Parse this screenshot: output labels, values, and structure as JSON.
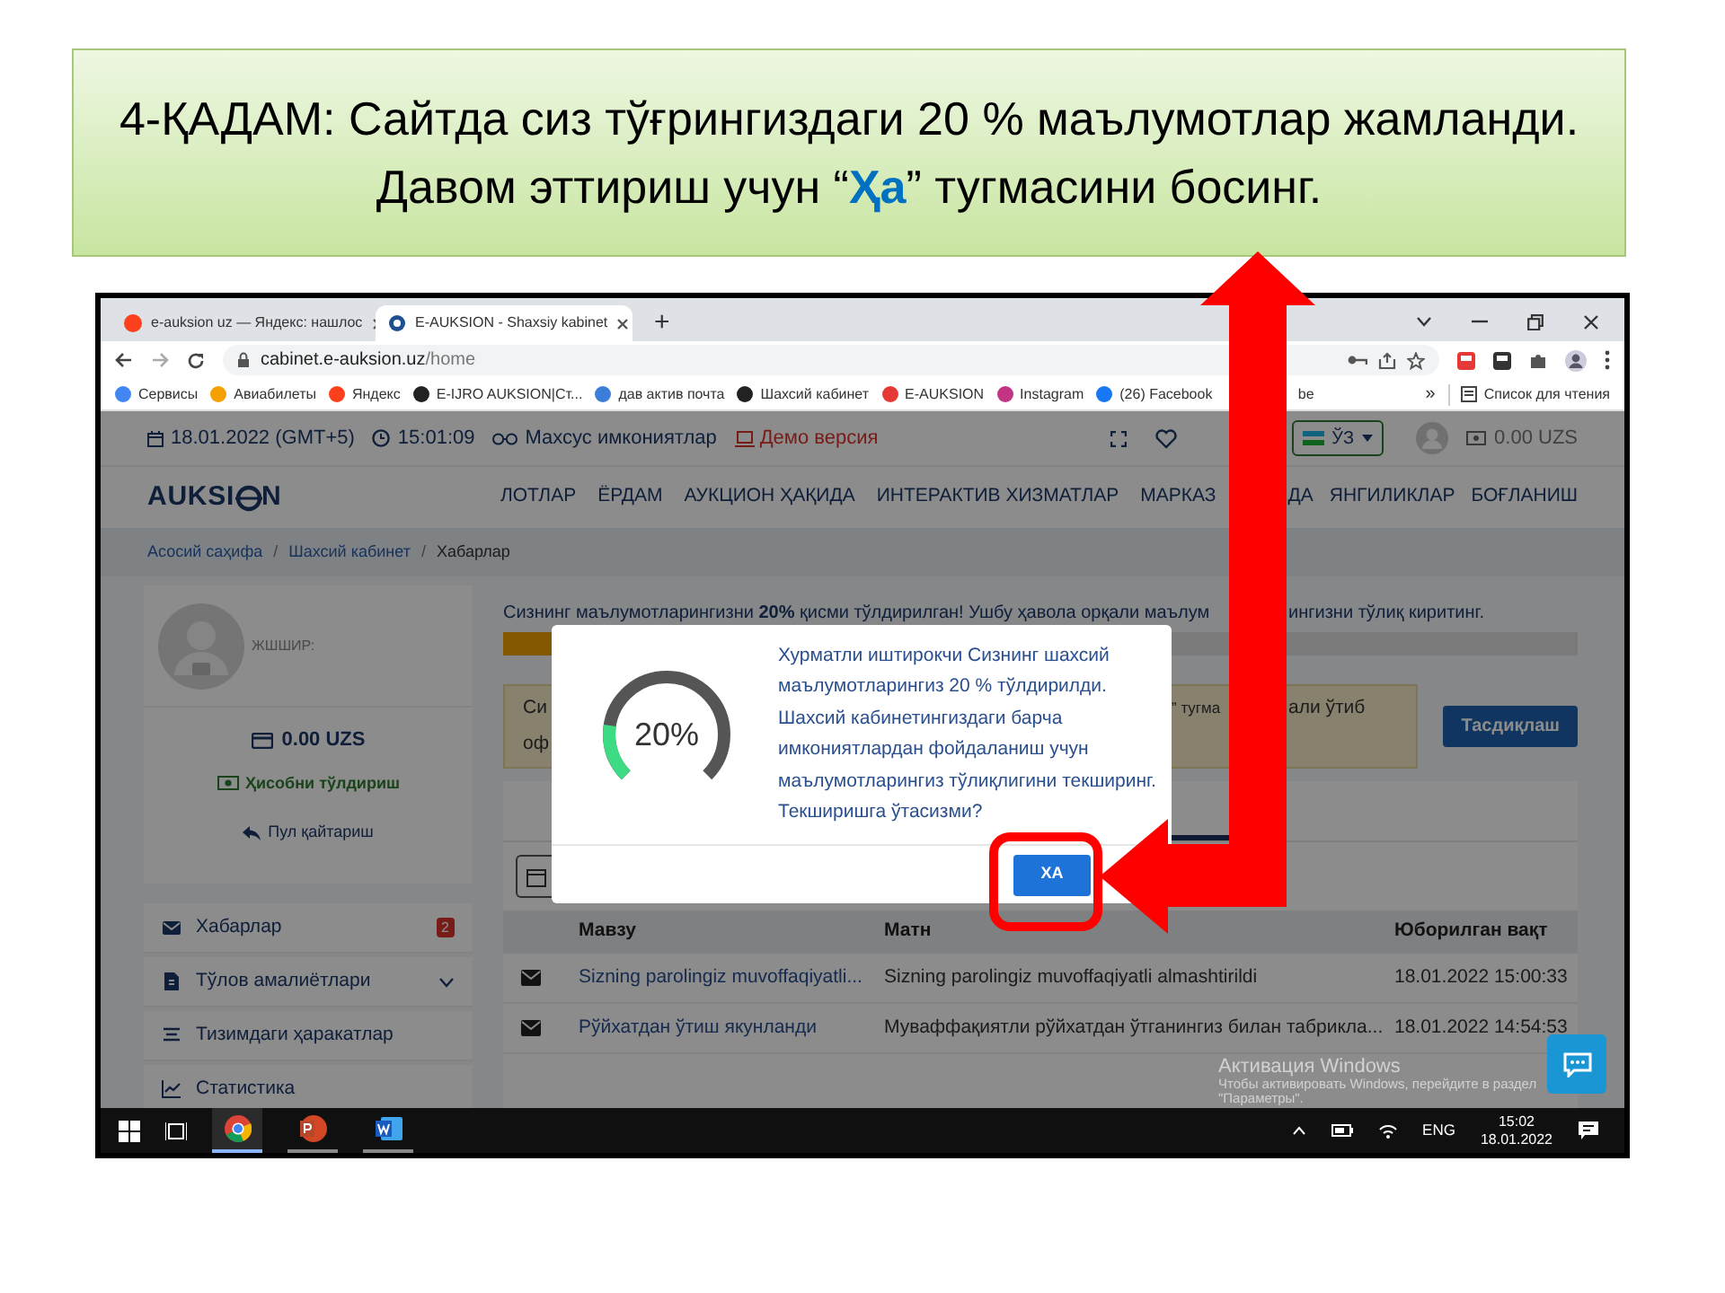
{
  "banner": {
    "text": "4-ҚАДАМ: Сайтда сиз тўғрингиздаги 20 % маълумотлар жамланди. Давом эттириш учун “**Ҳа**” тугмасини босинг."
  },
  "browser": {
    "tabs": [
      {
        "title": "e-auksion uz — Яндекс: нашлос",
        "selected": false
      },
      {
        "title": "E-AUKSION - Shaxsiy kabinet",
        "selected": true
      }
    ],
    "new_tab": "+",
    "url": {
      "domain": "cabinet.e-auksion.uz",
      "path": "/home"
    },
    "bookmarks": [
      "Сервисы",
      "Авиабилеты",
      "Яндекс",
      "E-IJRO AUKSION|Ст...",
      "дав актив почта",
      "Шахсий кабинет",
      "E-AUKSION",
      "Instagram",
      "(26) Facebook"
    ],
    "bookmark_tail": "be",
    "more": "»",
    "reading_list": "Список для чтения"
  },
  "topbar": {
    "date": "18.01.2022 (GMT+5)",
    "time": "15:01:09",
    "accessibility": "Махсус имкониятлар",
    "demo": "Демо версия",
    "language": "ЎЗ",
    "balance": "0.00 UZS"
  },
  "logo": {
    "left": "AUKSI",
    "right": "N"
  },
  "nav": [
    "ЛОТЛАР",
    "ЁРДАМ",
    "АУКЦИОН ҲАҚИДА",
    "ИНТЕРАКТИВ ХИЗМАТЛАР",
    "МАРКАЗ",
    "ДА",
    "ЯНГИЛИКЛАР",
    "БОҒЛАНИШ"
  ],
  "breadcrumb": [
    {
      "text": "Асосий саҳифа",
      "kind": "link"
    },
    {
      "text": "/",
      "kind": "separator"
    },
    {
      "text": "Шахсий кабинет",
      "kind": "link"
    },
    {
      "text": "/",
      "kind": "separator"
    },
    {
      "text": "Хабарлар",
      "kind": "current"
    }
  ],
  "profile": {
    "id_label": "ЖШШИР:",
    "balance": "0.00 UZS",
    "top_up": "Ҳисобни тўлдириш",
    "refund": "Пул қайтариш"
  },
  "menu": [
    {
      "label": "Хабарлар",
      "badge": "2"
    },
    {
      "label": "Тўлов амалиётлари",
      "expanded": false
    },
    {
      "label": "Тизимдаги ҳаракатлар"
    },
    {
      "label": "Статистика"
    }
  ],
  "progress": {
    "text_left": "Сизнинг маълумотларингизни **20%** қисми тўлдирилган! Ушбу ҳавола орқали маълум",
    "text_right": "ингизни тўлиқ киритинг.",
    "level": 0.2
  },
  "notice": {
    "line1_start": "Си",
    "line1_mid": "” тугма",
    "line1_end": "али ўтиб",
    "line2_start": "оф",
    "button": "Тасдиқлаш"
  },
  "table": {
    "columns": [
      "Мавзу",
      "Матн",
      "Юборилган вақт"
    ],
    "rows": [
      {
        "subject": "Sizning parolingiz muvoffaqiyatli...",
        "text": "Sizning parolingiz muvoffaqiyatli almashtirildi",
        "sent": "18.01.2022 15:00:33"
      },
      {
        "subject": "Рўйхатдан ўтиш якунланди",
        "text": "Муваффақиятли рўйхатдан ўтганингиз билан табрикла...",
        "sent": "18.01.2022 14:54:53"
      }
    ]
  },
  "modal": {
    "gauge": {
      "label": "20%",
      "level": 0.2
    },
    "message": "Хурматли иштирокчи Сизнинг шахсий маълумотларингиз 20 % тўлдирилди. Шахсий кабинетингиздаги барча имкониятлардан фойдаланиш учун маълумотларингиз тўлиқлигини текширинг. Текширишга ўтасизми?",
    "button": "ХА"
  },
  "activation": {
    "title": "Активация Windows",
    "text": "Чтобы активировать Windows, перейдите в раздел \"Параметры\"."
  },
  "taskbar": {
    "language": "ENG",
    "time": "15:02",
    "date": "18.01.2022"
  }
}
